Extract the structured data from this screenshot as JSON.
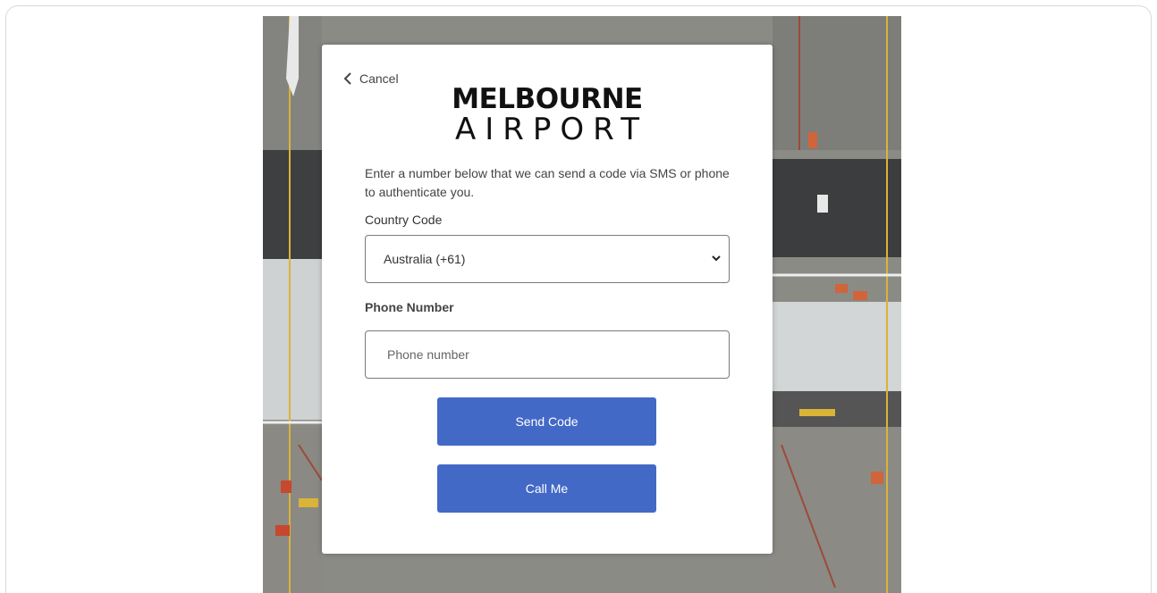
{
  "login": {
    "cancel_label": "Cancel",
    "logo_line1": "MELBOURNE",
    "logo_line2": "AIRPORT",
    "intro_text": "Enter a number below that we can send a code via SMS or phone to authenticate you.",
    "country_code_label": "Country Code",
    "country_code_value": "Australia (+61)",
    "phone_label": "Phone Number",
    "phone_placeholder": "Phone number",
    "send_code_label": "Send Code",
    "call_me_label": "Call Me"
  },
  "colors": {
    "button": "#4369c7",
    "background_photo": "aerial-airport-apron"
  }
}
